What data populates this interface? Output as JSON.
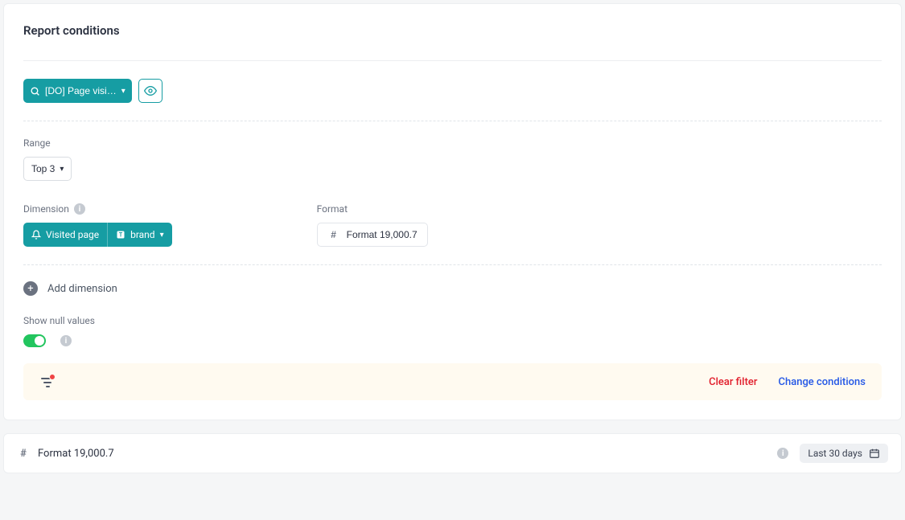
{
  "title": "Report conditions",
  "event_chip": {
    "label": "[DO] Page visi…"
  },
  "range": {
    "label": "Range",
    "value": "Top 3"
  },
  "dimension": {
    "label": "Dimension",
    "chip_primary": "Visited page",
    "chip_secondary": "brand"
  },
  "format": {
    "label": "Format",
    "value": "Format 19,000.7"
  },
  "add_dimension": "Add dimension",
  "show_null": {
    "label": "Show null values",
    "on": true
  },
  "filter_bar": {
    "clear": "Clear filter",
    "change": "Change conditions"
  },
  "footer": {
    "format_summary": "Format 19,000.7",
    "date_range": "Last 30 days"
  }
}
